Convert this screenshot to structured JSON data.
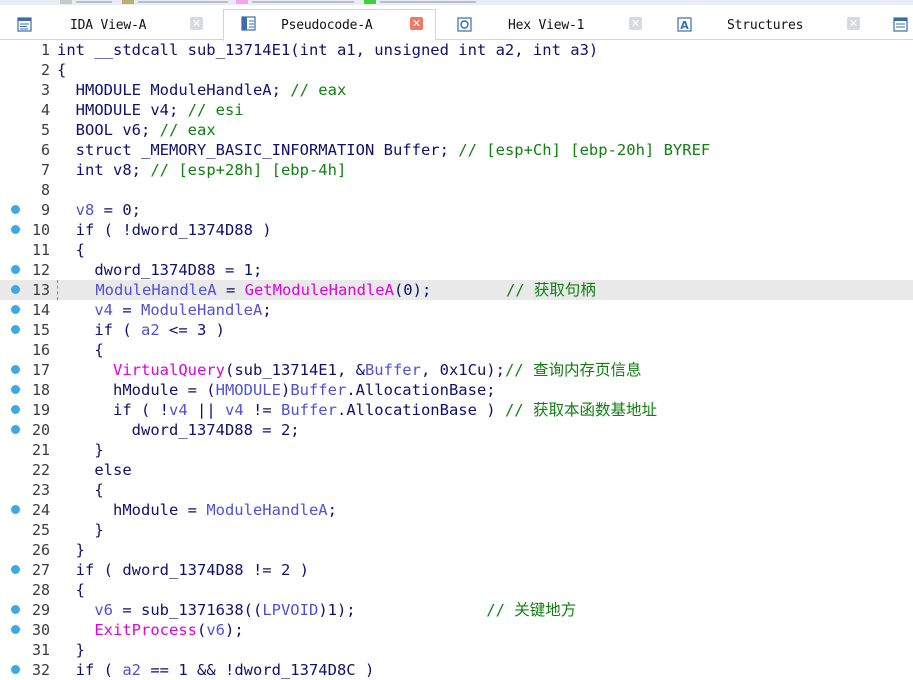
{
  "tabs": [
    {
      "label": "IDA View-A",
      "icon": "ida-view-icon",
      "active": false,
      "close": "gray"
    },
    {
      "label": "Pseudocode-A",
      "icon": "pseudocode-icon",
      "active": true,
      "close": "red"
    },
    {
      "label": "Hex View-1",
      "icon": "hex-view-icon",
      "active": false,
      "close": "gray"
    },
    {
      "label": "Structures",
      "icon": "structures-icon",
      "active": false,
      "close": "gray"
    }
  ],
  "colors": {
    "accent_dot": "#3ca8e4",
    "function": "#e000e0",
    "variable": "#5050d8",
    "comment": "#108010",
    "default": "#101070",
    "highlight_line": "#e9e9e9"
  },
  "lines": [
    {
      "n": "1",
      "dot": false,
      "segs": [
        [
          "n",
          "int __stdcall sub_13714E1(int a1, unsigned int a2, int a3)"
        ]
      ]
    },
    {
      "n": "2",
      "dot": false,
      "segs": [
        [
          "n",
          "{"
        ]
      ]
    },
    {
      "n": "3",
      "dot": false,
      "segs": [
        [
          "n",
          "  HMODULE ModuleHandleA; "
        ],
        [
          "c",
          "// eax"
        ]
      ]
    },
    {
      "n": "4",
      "dot": false,
      "segs": [
        [
          "n",
          "  HMODULE v4; "
        ],
        [
          "c",
          "// esi"
        ]
      ]
    },
    {
      "n": "5",
      "dot": false,
      "segs": [
        [
          "n",
          "  BOOL v6; "
        ],
        [
          "c",
          "// eax"
        ]
      ]
    },
    {
      "n": "6",
      "dot": false,
      "segs": [
        [
          "n",
          "  struct _MEMORY_BASIC_INFORMATION Buffer; "
        ],
        [
          "c",
          "// [esp+Ch] [ebp-20h] BYREF"
        ]
      ]
    },
    {
      "n": "7",
      "dot": false,
      "segs": [
        [
          "n",
          "  int v8; "
        ],
        [
          "c",
          "// [esp+28h] [ebp-4h]"
        ]
      ]
    },
    {
      "n": "8",
      "dot": false,
      "segs": [
        [
          "n",
          ""
        ]
      ]
    },
    {
      "n": "9",
      "dot": true,
      "segs": [
        [
          "v",
          "  v8"
        ],
        [
          "n",
          " = 0;"
        ]
      ]
    },
    {
      "n": "10",
      "dot": true,
      "segs": [
        [
          "n",
          "  if ( !dword_1374D88 )"
        ]
      ]
    },
    {
      "n": "11",
      "dot": false,
      "segs": [
        [
          "n",
          "  {"
        ]
      ]
    },
    {
      "n": "12",
      "dot": true,
      "segs": [
        [
          "n",
          "    dword_1374D88 = 1;"
        ]
      ]
    },
    {
      "n": "13",
      "dot": true,
      "hl": true,
      "segs": [
        [
          "v",
          "    ModuleHandleA"
        ],
        [
          "n",
          " = "
        ],
        [
          "f",
          "GetModuleHandleA"
        ],
        [
          "n",
          "(0);        "
        ],
        [
          "c",
          "// 获取句柄"
        ]
      ]
    },
    {
      "n": "14",
      "dot": true,
      "segs": [
        [
          "v",
          "    v4"
        ],
        [
          "n",
          " = "
        ],
        [
          "v",
          "ModuleHandleA"
        ],
        [
          "n",
          ";"
        ]
      ]
    },
    {
      "n": "15",
      "dot": true,
      "segs": [
        [
          "n",
          "    if ( "
        ],
        [
          "v",
          "a2"
        ],
        [
          "n",
          " <= 3 )"
        ]
      ]
    },
    {
      "n": "16",
      "dot": false,
      "segs": [
        [
          "n",
          "    {"
        ]
      ]
    },
    {
      "n": "17",
      "dot": true,
      "segs": [
        [
          "f",
          "      VirtualQuery"
        ],
        [
          "n",
          "(sub_13714E1, &"
        ],
        [
          "v",
          "Buffer"
        ],
        [
          "n",
          ", 0x1Cu);"
        ],
        [
          "c",
          "// 查询内存页信息"
        ]
      ]
    },
    {
      "n": "18",
      "dot": true,
      "segs": [
        [
          "n",
          "      hModule = ("
        ],
        [
          "v",
          "HMODULE"
        ],
        [
          "n",
          ")"
        ],
        [
          "v",
          "Buffer"
        ],
        [
          "n",
          ".AllocationBase;"
        ]
      ]
    },
    {
      "n": "19",
      "dot": true,
      "segs": [
        [
          "n",
          "      if ( !"
        ],
        [
          "v",
          "v4"
        ],
        [
          "n",
          " || "
        ],
        [
          "v",
          "v4"
        ],
        [
          "n",
          " != "
        ],
        [
          "v",
          "Buffer"
        ],
        [
          "n",
          ".AllocationBase ) "
        ],
        [
          "c",
          "// 获取本函数基地址"
        ]
      ]
    },
    {
      "n": "20",
      "dot": true,
      "segs": [
        [
          "n",
          "        dword_1374D88 = 2;"
        ]
      ]
    },
    {
      "n": "21",
      "dot": false,
      "segs": [
        [
          "n",
          "    }"
        ]
      ]
    },
    {
      "n": "22",
      "dot": false,
      "segs": [
        [
          "n",
          "    else"
        ]
      ]
    },
    {
      "n": "23",
      "dot": false,
      "segs": [
        [
          "n",
          "    {"
        ]
      ]
    },
    {
      "n": "24",
      "dot": true,
      "segs": [
        [
          "n",
          "      hModule = "
        ],
        [
          "v",
          "ModuleHandleA"
        ],
        [
          "n",
          ";"
        ]
      ]
    },
    {
      "n": "25",
      "dot": false,
      "segs": [
        [
          "n",
          "    }"
        ]
      ]
    },
    {
      "n": "26",
      "dot": false,
      "segs": [
        [
          "n",
          "  }"
        ]
      ]
    },
    {
      "n": "27",
      "dot": true,
      "segs": [
        [
          "n",
          "  if ( dword_1374D88 != 2 )"
        ]
      ]
    },
    {
      "n": "28",
      "dot": false,
      "segs": [
        [
          "n",
          "  {"
        ]
      ]
    },
    {
      "n": "29",
      "dot": true,
      "segs": [
        [
          "v",
          "    v6"
        ],
        [
          "n",
          " = sub_1371638(("
        ],
        [
          "v",
          "LPVOID"
        ],
        [
          "n",
          ")1);              "
        ],
        [
          "c",
          "// 关键地方"
        ]
      ]
    },
    {
      "n": "30",
      "dot": true,
      "segs": [
        [
          "f",
          "    ExitProcess"
        ],
        [
          "n",
          "("
        ],
        [
          "v",
          "v6"
        ],
        [
          "n",
          ");"
        ]
      ]
    },
    {
      "n": "31",
      "dot": false,
      "segs": [
        [
          "n",
          "  }"
        ]
      ]
    },
    {
      "n": "32",
      "dot": true,
      "segs": [
        [
          "n",
          "  if ( "
        ],
        [
          "v",
          "a2"
        ],
        [
          "n",
          " == 1 && !dword_1374D8C )"
        ]
      ]
    }
  ]
}
